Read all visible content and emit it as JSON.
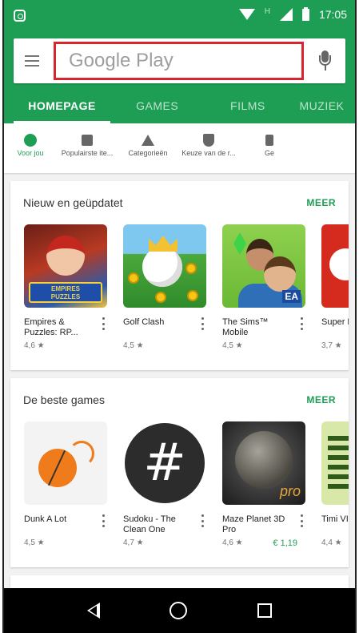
{
  "status_bar": {
    "signal_type": "H",
    "time": "17:05",
    "icons": [
      "instagram-icon",
      "wifi-icon",
      "cell-signal-icon",
      "battery-icon"
    ]
  },
  "search": {
    "placeholder": "Google Play",
    "icons": [
      "menu-icon",
      "mic-icon"
    ]
  },
  "tabs": [
    {
      "label": "HOMEPAGE",
      "active": true
    },
    {
      "label": "GAMES",
      "active": false
    },
    {
      "label": "FILMS",
      "active": false
    },
    {
      "label": "MUZIEK",
      "active": false
    }
  ],
  "subcategories": [
    {
      "label": "Voor jou",
      "icon": "compass-icon",
      "active": true
    },
    {
      "label": "Populairste ite...",
      "icon": "chart-icon",
      "active": false
    },
    {
      "label": "Categorieën",
      "icon": "shapes-icon",
      "active": false
    },
    {
      "label": "Keuze van de r...",
      "icon": "badge-icon",
      "active": false
    },
    {
      "label": "Ge",
      "icon": "more-icon",
      "active": false
    }
  ],
  "sections": [
    {
      "title": "Nieuw en geüpdatet",
      "more_label": "MEER",
      "apps": [
        {
          "name": "Empires & Puzzles: RP...",
          "rating": "4,6 ★",
          "price": ""
        },
        {
          "name": "Golf Clash",
          "rating": "4,5 ★",
          "price": ""
        },
        {
          "name": "The Sims™ Mobile",
          "rating": "4,5 ★",
          "price": ""
        },
        {
          "name": "Super Run",
          "rating": "3,7 ★",
          "price": ""
        }
      ]
    },
    {
      "title": "De beste games",
      "more_label": "MEER",
      "apps": [
        {
          "name": "Dunk A Lot",
          "rating": "4,5 ★",
          "price": ""
        },
        {
          "name": "Sudoku - The Clean One",
          "rating": "4,7 ★",
          "price": ""
        },
        {
          "name": "Maze Planet 3D Pro",
          "rating": "4,6 ★",
          "price": "€ 1,19"
        },
        {
          "name": "Timi VIP -",
          "rating": "4,4 ★",
          "price": ""
        }
      ]
    }
  ],
  "colors": {
    "brand_green": "#1e9e55",
    "highlight_red": "#d9262e"
  }
}
